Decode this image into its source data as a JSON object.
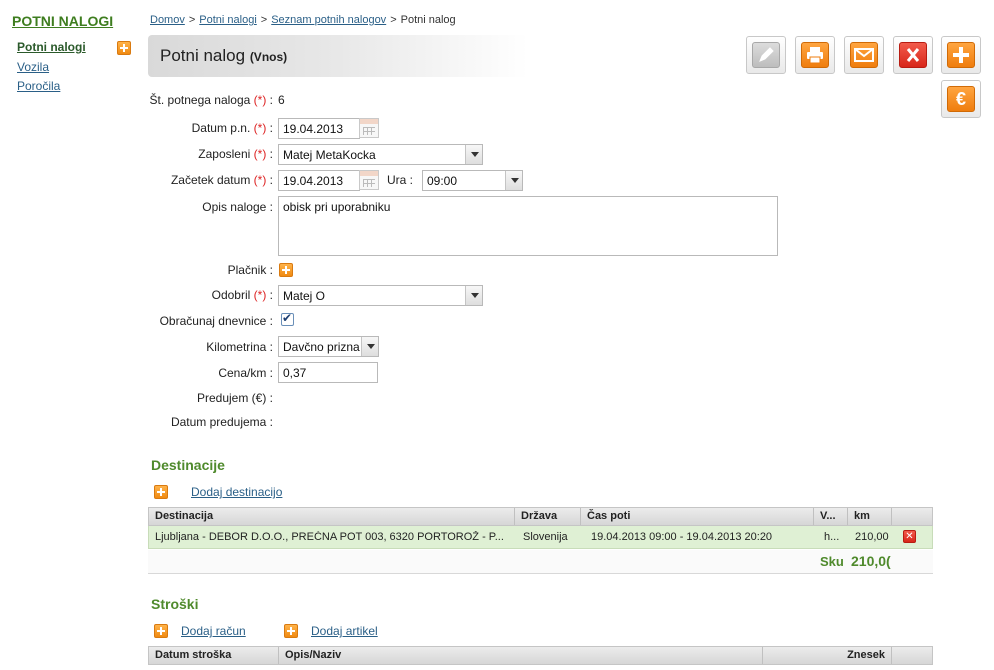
{
  "sidebar": {
    "title": "POTNI NALOGI",
    "items": [
      {
        "label": "Potni nalogi"
      },
      {
        "label": "Vozila"
      },
      {
        "label": "Poročila"
      }
    ]
  },
  "breadcrumb": {
    "items": [
      "Domov",
      "Potni nalogi",
      "Seznam potnih nalogov"
    ],
    "current": "Potni nalog",
    "separator": ">"
  },
  "header": {
    "title": "Potni nalog",
    "mode": "(Vnos)"
  },
  "toolbar": {
    "icons": [
      "edit-icon",
      "print-icon",
      "mail-icon",
      "delete-icon",
      "add-icon",
      "euro-icon"
    ],
    "euro_symbol": "€"
  },
  "form": {
    "required_mark": "(*)",
    "stevilka_label": "Št. potnega naloga",
    "stevilka_value": "6",
    "datum_label": "Datum p.n.",
    "datum_value": "19.04.2013",
    "zaposleni_label": "Zaposleni",
    "zaposleni_value": "Matej MetaKocka",
    "zacetek_label": "Začetek datum",
    "zacetek_value": "19.04.2013",
    "ura_label": "Ura :",
    "ura_value": "09:00",
    "opis_label": "Opis naloge :",
    "opis_value": "obisk pri uporabniku",
    "placnik_label": "Plačnik :",
    "odobril_label": "Odobril",
    "odobril_value": "Matej O",
    "dnevnice_label": "Obračunaj dnevnice :",
    "dnevnice_checked": true,
    "kilometrina_label": "Kilometrina :",
    "kilometrina_value": "Davčno prizna",
    "cena_label": "Cena/km :",
    "cena_value": "0,37",
    "predujem_label": "Predujem (€) :",
    "datum_predujema_label": "Datum predujema :"
  },
  "destinacije": {
    "title": "Destinacije",
    "add_label": "Dodaj destinacijo",
    "columns": [
      "Destinacija",
      "Država",
      "Čas poti",
      "V...",
      "km"
    ],
    "rows": [
      {
        "destinacija": "Ljubljana - DEBOR D.O.O., PREČNA POT 003, 6320 PORTOROŽ - P...",
        "drzava": "Slovenija",
        "cas": "19.04.2013 09:00 - 19.04.2013 20:20",
        "v": "h...",
        "km": "210,00"
      }
    ],
    "sum_label": "Sku",
    "sum_value": "210,0("
  },
  "stroski": {
    "title": "Stroški",
    "add_racun_label": "Dodaj račun",
    "add_artikel_label": "Dodaj artikel",
    "columns": [
      "Datum stroška",
      "Opis/Naziv",
      "Znesek"
    ]
  },
  "colors": {
    "accent_green": "#4f8a2c",
    "link_blue": "#2a5f87",
    "row_green": "#dff0d4",
    "orange": "#ef7d0e",
    "red": "#d8261a"
  }
}
